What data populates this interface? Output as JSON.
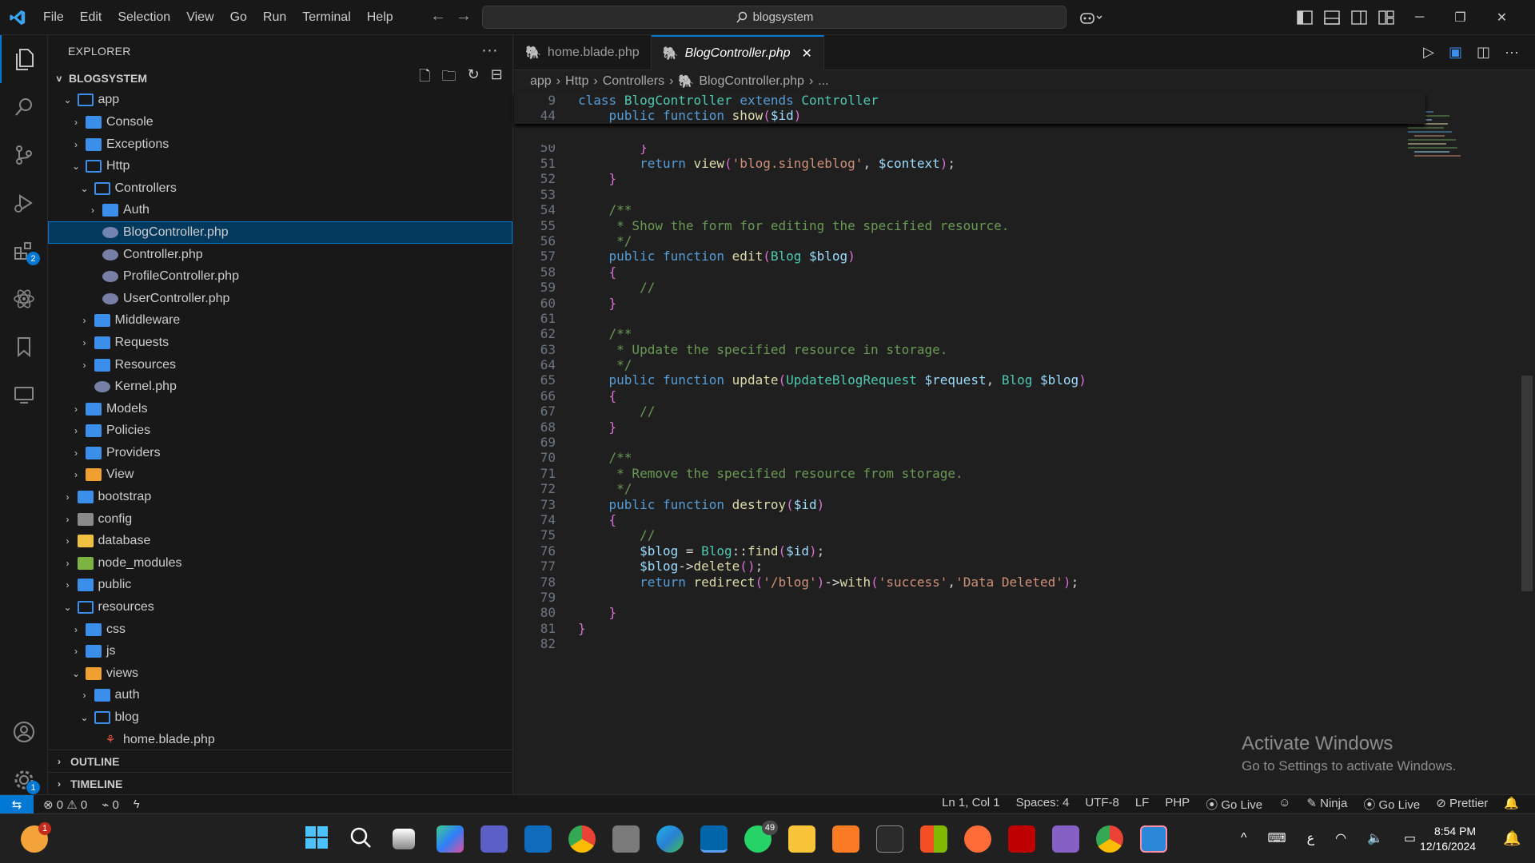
{
  "titlebar": {
    "menu": [
      "File",
      "Edit",
      "Selection",
      "View",
      "Go",
      "Run",
      "Terminal",
      "Help"
    ],
    "search": "blogsystem"
  },
  "sidebar": {
    "title": "EXPLORER",
    "root": "BLOGSYSTEM",
    "tree": [
      {
        "label": "app",
        "depth": 1,
        "type": "folder-open",
        "twist": "v"
      },
      {
        "label": "Console",
        "depth": 2,
        "type": "folder",
        "twist": ">"
      },
      {
        "label": "Exceptions",
        "depth": 2,
        "type": "folder",
        "twist": ">"
      },
      {
        "label": "Http",
        "depth": 2,
        "type": "folder-open",
        "twist": "v"
      },
      {
        "label": "Controllers",
        "depth": 3,
        "type": "folder-open",
        "twist": "v"
      },
      {
        "label": "Auth",
        "depth": 4,
        "type": "folder",
        "twist": ">"
      },
      {
        "label": "BlogController.php",
        "depth": 4,
        "type": "php",
        "twist": "",
        "selected": true
      },
      {
        "label": "Controller.php",
        "depth": 4,
        "type": "php",
        "twist": ""
      },
      {
        "label": "ProfileController.php",
        "depth": 4,
        "type": "php",
        "twist": ""
      },
      {
        "label": "UserController.php",
        "depth": 4,
        "type": "php",
        "twist": ""
      },
      {
        "label": "Middleware",
        "depth": 3,
        "type": "folder",
        "twist": ">"
      },
      {
        "label": "Requests",
        "depth": 3,
        "type": "folder",
        "twist": ">"
      },
      {
        "label": "Resources",
        "depth": 3,
        "type": "folder",
        "twist": ">"
      },
      {
        "label": "Kernel.php",
        "depth": 3,
        "type": "php",
        "twist": ""
      },
      {
        "label": "Models",
        "depth": 2,
        "type": "folder",
        "twist": ">"
      },
      {
        "label": "Policies",
        "depth": 2,
        "type": "folder",
        "twist": ">"
      },
      {
        "label": "Providers",
        "depth": 2,
        "type": "folder",
        "twist": ">"
      },
      {
        "label": "View",
        "depth": 2,
        "type": "folder-code",
        "twist": ">"
      },
      {
        "label": "bootstrap",
        "depth": 1,
        "type": "folder",
        "twist": ">"
      },
      {
        "label": "config",
        "depth": 1,
        "type": "folder-config",
        "twist": ">"
      },
      {
        "label": "database",
        "depth": 1,
        "type": "folder-db",
        "twist": ">"
      },
      {
        "label": "node_modules",
        "depth": 1,
        "type": "folder-node",
        "twist": ">"
      },
      {
        "label": "public",
        "depth": 1,
        "type": "folder",
        "twist": ">"
      },
      {
        "label": "resources",
        "depth": 1,
        "type": "folder-open",
        "twist": "v"
      },
      {
        "label": "css",
        "depth": 2,
        "type": "folder",
        "twist": ">"
      },
      {
        "label": "js",
        "depth": 2,
        "type": "folder",
        "twist": ">"
      },
      {
        "label": "views",
        "depth": 2,
        "type": "folder-code",
        "twist": "v"
      },
      {
        "label": "auth",
        "depth": 3,
        "type": "folder",
        "twist": ">"
      },
      {
        "label": "blog",
        "depth": 3,
        "type": "folder-open",
        "twist": "v"
      },
      {
        "label": "home.blade.php",
        "depth": 4,
        "type": "blade",
        "twist": ""
      }
    ],
    "outline": "OUTLINE",
    "timeline": "TIMELINE"
  },
  "tabs": [
    {
      "label": "home.blade.php",
      "active": false
    },
    {
      "label": "BlogController.php",
      "active": true
    }
  ],
  "breadcrumb": [
    "app",
    "Http",
    "Controllers",
    "BlogController.php",
    "..."
  ],
  "sticky": [
    {
      "n": "9",
      "t": "class BlogController extends Controller"
    },
    {
      "n": "44",
      "t": "    public function show($id)"
    }
  ],
  "code": [
    {
      "n": "51",
      "t": "        return view('blog.singleblog', $context);"
    },
    {
      "n": "52",
      "t": "    }"
    },
    {
      "n": "53",
      "t": ""
    },
    {
      "n": "54",
      "t": "    /**"
    },
    {
      "n": "55",
      "t": "     * Show the form for editing the specified resource."
    },
    {
      "n": "56",
      "t": "     */"
    },
    {
      "n": "57",
      "t": "    public function edit(Blog $blog)"
    },
    {
      "n": "58",
      "t": "    {"
    },
    {
      "n": "59",
      "t": "        //"
    },
    {
      "n": "60",
      "t": "    }"
    },
    {
      "n": "61",
      "t": ""
    },
    {
      "n": "62",
      "t": "    /**"
    },
    {
      "n": "63",
      "t": "     * Update the specified resource in storage."
    },
    {
      "n": "64",
      "t": "     */"
    },
    {
      "n": "65",
      "t": "    public function update(UpdateBlogRequest $request, Blog $blog)"
    },
    {
      "n": "66",
      "t": "    {"
    },
    {
      "n": "67",
      "t": "        //"
    },
    {
      "n": "68",
      "t": "    }"
    },
    {
      "n": "69",
      "t": ""
    },
    {
      "n": "70",
      "t": "    /**"
    },
    {
      "n": "71",
      "t": "     * Remove the specified resource from storage."
    },
    {
      "n": "72",
      "t": "     */"
    },
    {
      "n": "73",
      "t": "    public function destroy($id)"
    },
    {
      "n": "74",
      "t": "    {"
    },
    {
      "n": "75",
      "t": "        //"
    },
    {
      "n": "76",
      "t": "        $blog = Blog::find($id);"
    },
    {
      "n": "77",
      "t": "        $blog->delete();"
    },
    {
      "n": "78",
      "t": "        return redirect('/blog')->with('success','Data Deleted');"
    },
    {
      "n": "79",
      "t": ""
    },
    {
      "n": "80",
      "t": "    }"
    },
    {
      "n": "81",
      "t": "}"
    },
    {
      "n": "82",
      "t": ""
    }
  ],
  "watermark": {
    "line1": "Activate Windows",
    "line2": "Go to Settings to activate Windows."
  },
  "status": {
    "errors": "0",
    "warnings": "0",
    "ports": "0",
    "position": "Ln 1, Col 1",
    "spaces": "Spaces: 4",
    "encoding": "UTF-8",
    "eol": "LF",
    "lang": "PHP",
    "golive1": "Go Live",
    "ninja": "Ninja",
    "golive2": "Go Live",
    "prettier": "Prettier"
  },
  "taskbar": {
    "time": "8:54 PM",
    "date": "12/16/2024",
    "lang": "ع",
    "whatsapp_badge": "49",
    "weather_badge": "1"
  },
  "badges": {
    "extensions": "2",
    "accounts": "1"
  }
}
